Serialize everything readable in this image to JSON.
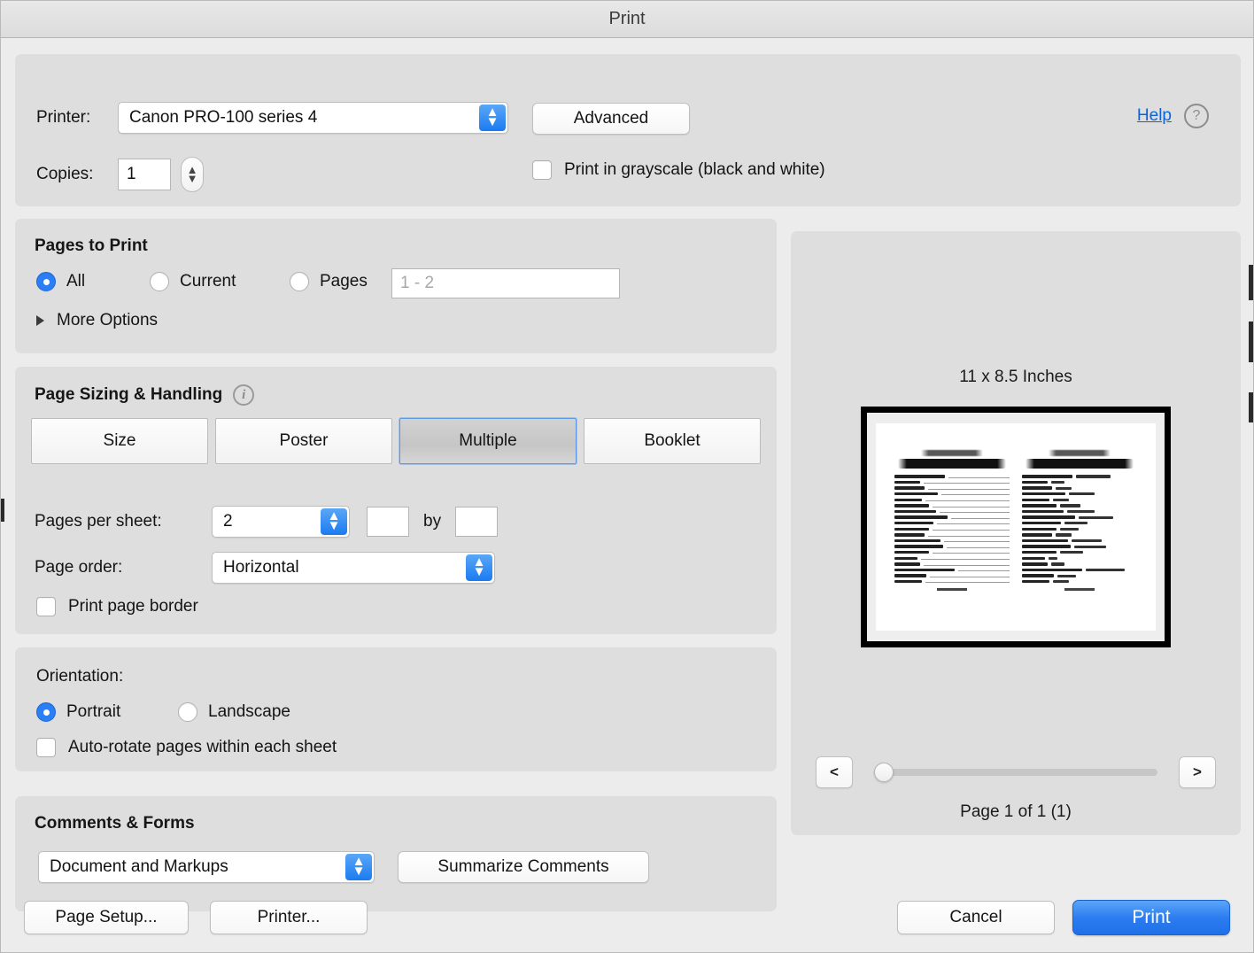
{
  "window": {
    "title": "Print"
  },
  "printer_section": {
    "printer_label": "Printer:",
    "printer_value": "Canon PRO-100 series 4",
    "advanced_label": "Advanced",
    "help_label": "Help",
    "help_icon_glyph": "?",
    "copies_label": "Copies:",
    "copies_value": "1",
    "grayscale_label": "Print in grayscale (black and white)",
    "grayscale_checked": false
  },
  "pages_to_print": {
    "title": "Pages to Print",
    "options": [
      {
        "label": "All",
        "selected": true
      },
      {
        "label": "Current",
        "selected": false
      },
      {
        "label": "Pages",
        "selected": false
      }
    ],
    "pages_range_value": "",
    "pages_range_placeholder": "1 - 2",
    "more_options_label": "More Options"
  },
  "page_sizing": {
    "title": "Page Sizing & Handling",
    "info_icon_glyph": "i",
    "tabs": [
      {
        "label": "Size",
        "selected": false
      },
      {
        "label": "Poster",
        "selected": false
      },
      {
        "label": "Multiple",
        "selected": true
      },
      {
        "label": "Booklet",
        "selected": false
      }
    ],
    "pages_per_sheet_label": "Pages per sheet:",
    "pages_per_sheet_value": "2",
    "custom_rows_value": "",
    "by_label": "by",
    "custom_cols_value": "",
    "page_order_label": "Page order:",
    "page_order_value": "Horizontal",
    "print_page_border_label": "Print page border",
    "print_page_border_checked": false
  },
  "orientation": {
    "title": "Orientation:",
    "options": [
      {
        "label": "Portrait",
        "selected": true
      },
      {
        "label": "Landscape",
        "selected": false
      }
    ],
    "auto_rotate_label": "Auto-rotate pages within each sheet",
    "auto_rotate_checked": false
  },
  "comments_forms": {
    "title": "Comments & Forms",
    "select_value": "Document and Markups",
    "summarize_label": "Summarize Comments"
  },
  "preview": {
    "size_label": "11 x 8.5 Inches",
    "page_count_label": "Page 1 of 1 (1)",
    "prev_label": "<",
    "next_label": ">",
    "document_title_line1": "Bridal Shower",
    "document_title_line2": "word scramble"
  },
  "footer": {
    "page_setup_label": "Page Setup...",
    "printer_label": "Printer...",
    "cancel_label": "Cancel",
    "print_label": "Print"
  },
  "colors": {
    "accent": "#2b7ef4",
    "link": "#0b63d6",
    "window_bg": "#ececec",
    "panel_bg": "#dedede"
  }
}
